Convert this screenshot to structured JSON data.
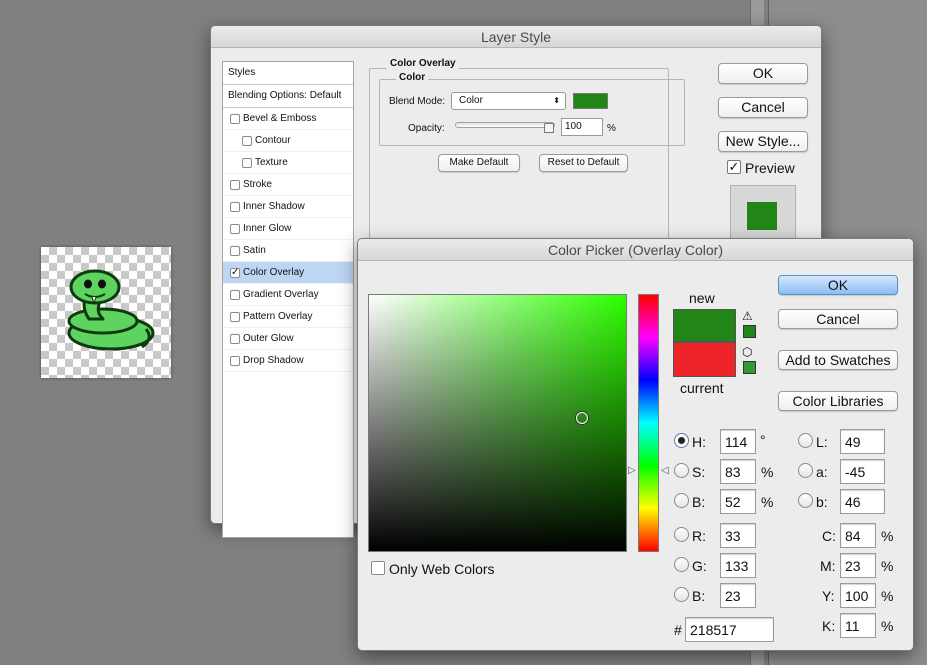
{
  "layer_style": {
    "title": "Layer Style",
    "styles_header": "Styles",
    "blending_options": "Blending Options: Default",
    "effects": [
      {
        "label": "Bevel & Emboss",
        "checked": false
      },
      {
        "label": "Contour",
        "checked": false
      },
      {
        "label": "Texture",
        "checked": false
      },
      {
        "label": "Stroke",
        "checked": false
      },
      {
        "label": "Inner Shadow",
        "checked": false
      },
      {
        "label": "Inner Glow",
        "checked": false
      },
      {
        "label": "Satin",
        "checked": false
      },
      {
        "label": "Color Overlay",
        "checked": true
      },
      {
        "label": "Gradient Overlay",
        "checked": false
      },
      {
        "label": "Pattern Overlay",
        "checked": false
      },
      {
        "label": "Outer Glow",
        "checked": false
      },
      {
        "label": "Drop Shadow",
        "checked": false
      }
    ],
    "overlay_group": "Color Overlay",
    "color_group": "Color",
    "blend_mode_label": "Blend Mode:",
    "blend_mode_value": "Color",
    "opacity_label": "Opacity:",
    "opacity_value": "100",
    "opacity_unit": "%",
    "make_default": "Make Default",
    "reset_default": "Reset to Default",
    "ok": "OK",
    "cancel": "Cancel",
    "new_style": "New Style...",
    "preview_label": "Preview",
    "preview_checked": true,
    "overlay_color": "#218517"
  },
  "color_picker": {
    "title": "Color Picker (Overlay Color)",
    "ok": "OK",
    "cancel": "Cancel",
    "add_to_swatches": "Add to Swatches",
    "color_libraries": "Color Libraries",
    "new_label": "new",
    "current_label": "current",
    "new_color": "#218517",
    "current_color": "#ee2428",
    "only_web_colors": "Only Web Colors",
    "hsb": {
      "h_label": "H:",
      "h": "114",
      "h_unit": "°",
      "s_label": "S:",
      "s": "83",
      "s_unit": "%",
      "b_label": "B:",
      "b": "52",
      "b_unit": "%"
    },
    "rgb": {
      "r_label": "R:",
      "r": "33",
      "g_label": "G:",
      "g": "133",
      "b_label": "B:",
      "b": "23"
    },
    "lab": {
      "l_label": "L:",
      "l": "49",
      "a_label": "a:",
      "a": "-45",
      "b_label": "b:",
      "b": "46"
    },
    "cmyk": {
      "c_label": "C:",
      "c": "84",
      "m_label": "M:",
      "m": "23",
      "y_label": "Y:",
      "y": "100",
      "k_label": "K:",
      "k": "11",
      "unit": "%"
    },
    "hex_label": "#",
    "hex": "218517",
    "selected_mode": "H"
  }
}
